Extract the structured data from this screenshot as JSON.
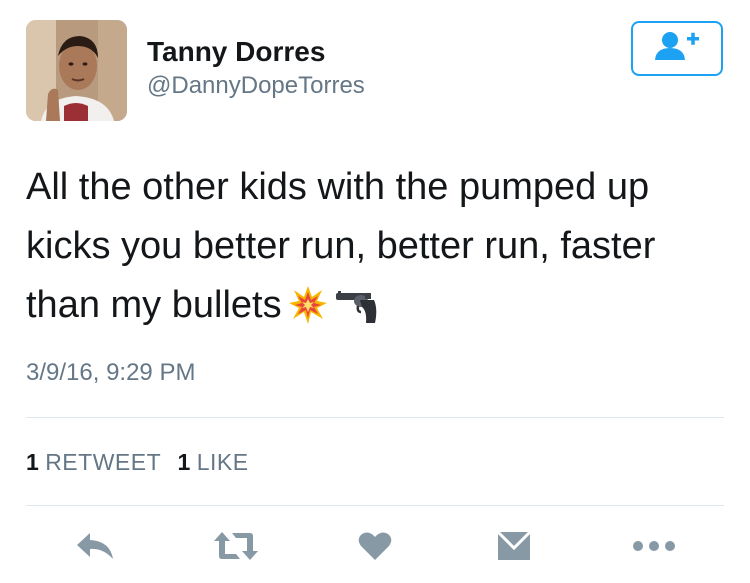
{
  "author": {
    "display_name": "Tanny Dorres",
    "handle": "@DannyDopeTorres"
  },
  "tweet": {
    "lines": [
      "All the other kids with the pumped up",
      "kicks you better run, better run, faster",
      "than my bullets"
    ],
    "emojis": [
      "collision-emoji",
      "pistol-emoji"
    ],
    "timestamp": "3/9/16, 9:29 PM"
  },
  "stats": {
    "retweets_count": "1",
    "retweets_label": "RETWEET",
    "likes_count": "1",
    "likes_label": "LIKE"
  },
  "actions": [
    "reply-icon",
    "retweet-icon",
    "like-icon",
    "direct-message-icon",
    "more-icon"
  ],
  "colors": {
    "accent": "#1da1f2",
    "text": "#14171a",
    "muted": "#657786",
    "icon": "#8899a6",
    "divider": "#e1e8ed"
  }
}
